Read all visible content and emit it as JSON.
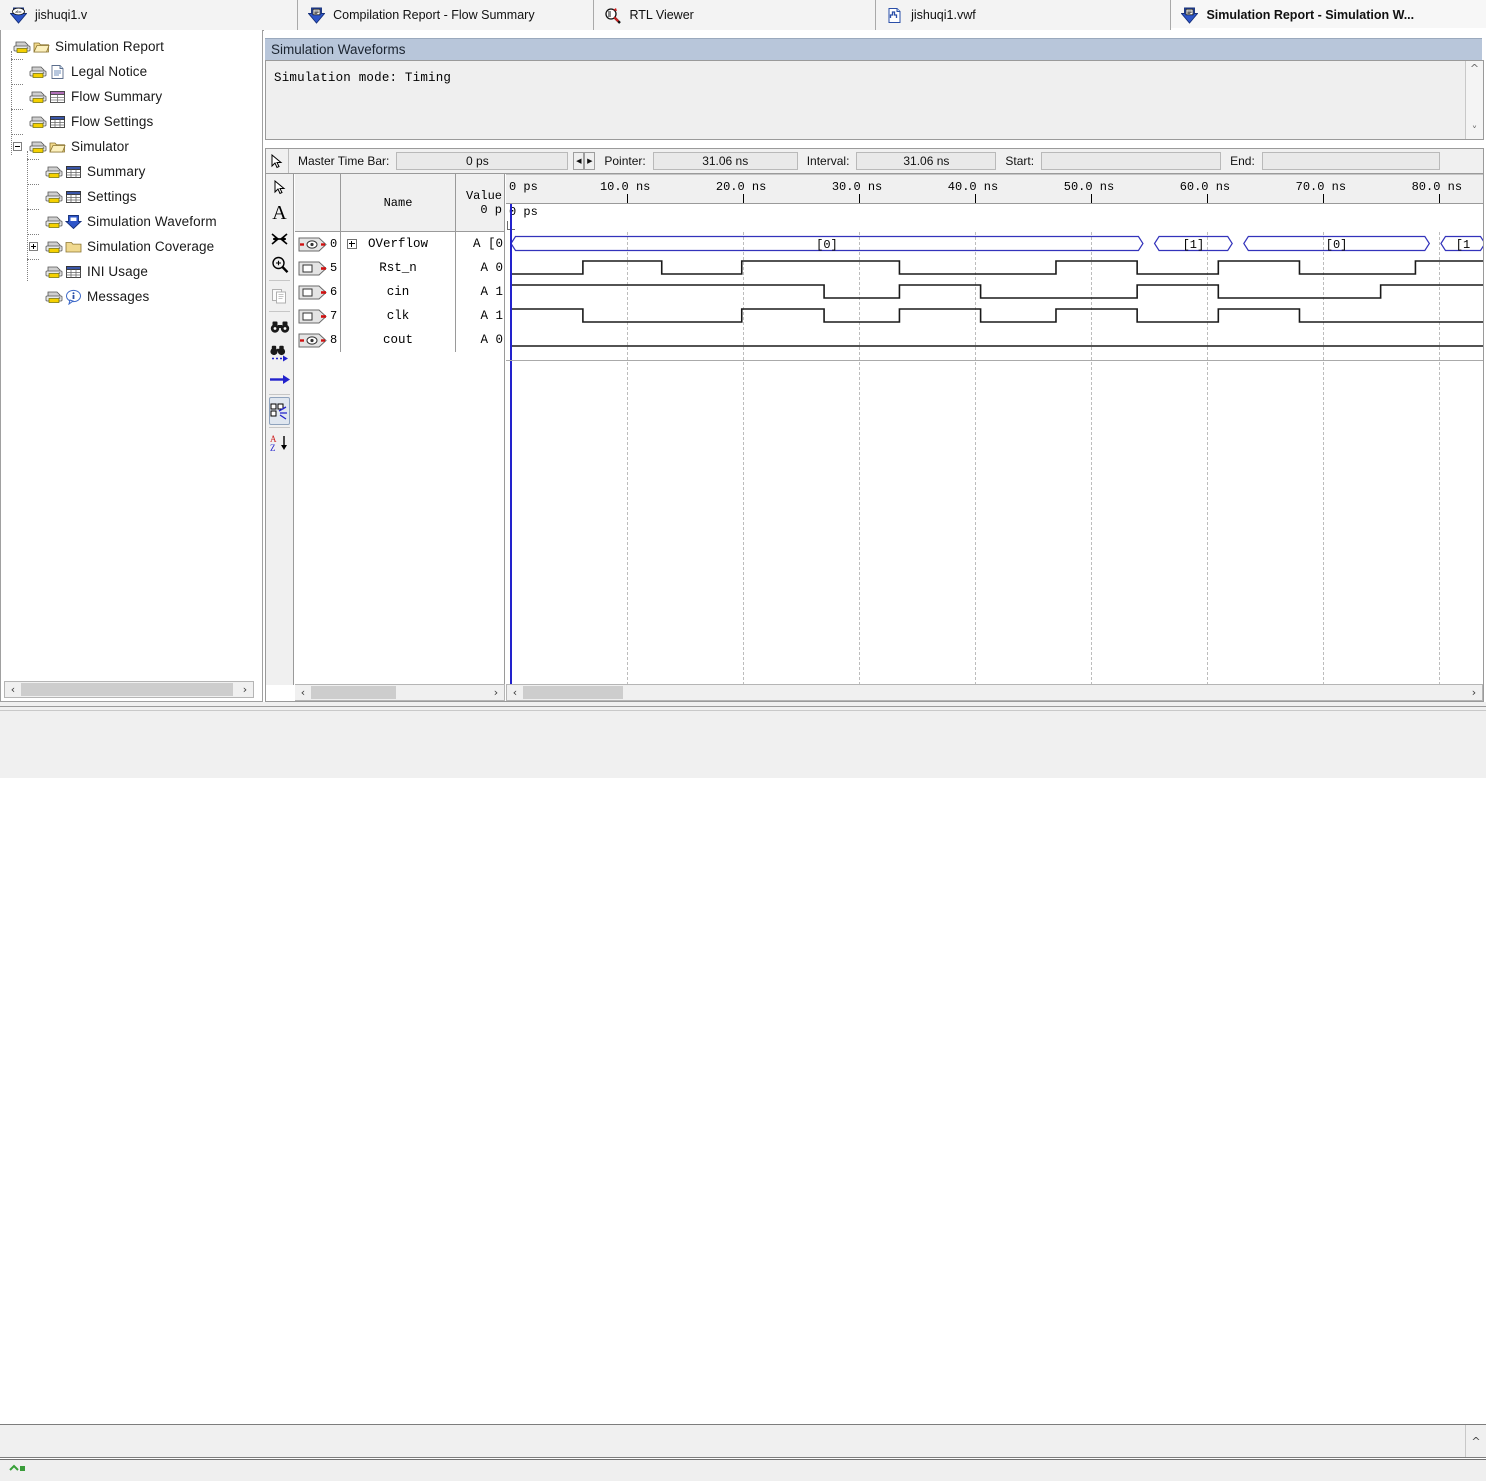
{
  "tabs": [
    {
      "label": "jishuqi1.v",
      "icon": "verilog-file-icon",
      "active": false
    },
    {
      "label": "Compilation Report - Flow Summary",
      "icon": "report-icon",
      "active": false
    },
    {
      "label": "RTL Viewer",
      "icon": "rtl-viewer-icon",
      "active": false
    },
    {
      "label": "jishuqi1.vwf",
      "icon": "waveform-file-icon",
      "active": false
    },
    {
      "label": "Simulation Report - Simulation W...",
      "icon": "report-icon",
      "active": true
    }
  ],
  "tree": {
    "items": [
      {
        "label": "Simulation Report",
        "icon": "folder-icon",
        "depth": 0,
        "expander": "none"
      },
      {
        "label": "Legal Notice",
        "icon": "document-icon",
        "depth": 1,
        "expander": "none"
      },
      {
        "label": "Flow Summary",
        "icon": "table-purple-icon",
        "depth": 1,
        "expander": "none"
      },
      {
        "label": "Flow Settings",
        "icon": "table-blue-icon",
        "depth": 1,
        "expander": "none"
      },
      {
        "label": "Simulator",
        "icon": "folder-icon",
        "depth": 1,
        "expander": "minus"
      },
      {
        "label": "Summary",
        "icon": "table-blue-icon",
        "depth": 2,
        "expander": "none"
      },
      {
        "label": "Settings",
        "icon": "table-blue-icon",
        "depth": 2,
        "expander": "none"
      },
      {
        "label": "Simulation Waveform",
        "icon": "waveform-icon",
        "depth": 2,
        "expander": "none"
      },
      {
        "label": "Simulation Coverage",
        "icon": "folder-closed-icon",
        "depth": 2,
        "expander": "plus"
      },
      {
        "label": "INI Usage",
        "icon": "table-blue-icon",
        "depth": 2,
        "expander": "none"
      },
      {
        "label": "Messages",
        "icon": "info-icon",
        "depth": 2,
        "expander": "none"
      }
    ]
  },
  "panel": {
    "header": "Simulation Waveforms",
    "mode_text": "Simulation mode: Timing"
  },
  "timebar": {
    "master_time_bar_label": "Master Time Bar:",
    "master_time_bar_value": "0 ps",
    "pointer_label": "Pointer:",
    "pointer_value": "31.06 ns",
    "interval_label": "Interval:",
    "interval_value": "31.06 ns",
    "start_label": "Start:",
    "start_value": "",
    "end_label": "End:",
    "end_value": ""
  },
  "vtools": [
    {
      "name": "selection-tool-icon",
      "glyph": "arrow"
    },
    {
      "name": "text-tool-icon",
      "glyph": "A"
    },
    {
      "name": "waveform-editing-tool-icon",
      "glyph": "scissors"
    },
    {
      "name": "zoom-tool-icon",
      "glyph": "magnifier"
    },
    {
      "name": "copy-icon",
      "glyph": "copy"
    },
    {
      "name": "find-icon",
      "glyph": "binoculars"
    },
    {
      "name": "find-next-icon",
      "glyph": "binoculars-next"
    },
    {
      "name": "goto-icon",
      "glyph": "arrow-right"
    },
    {
      "name": "group-ungroup-icon",
      "glyph": "nodes"
    },
    {
      "name": "sort-icon",
      "glyph": "az-sort"
    }
  ],
  "wave_table": {
    "headers": {
      "num": "",
      "name": "Name",
      "value_line1": "Value",
      "value_line2": "0 p"
    },
    "rows": [
      {
        "num": "0",
        "name": "OVerflow",
        "value": "A [0",
        "icon": "bidir-pin-icon",
        "expander": "plus"
      },
      {
        "num": "5",
        "name": "Rst_n",
        "value": "A 0",
        "icon": "input-pin-icon",
        "expander": "none"
      },
      {
        "num": "6",
        "name": "cin",
        "value": "A 1",
        "icon": "input-pin-icon",
        "expander": "none"
      },
      {
        "num": "7",
        "name": "clk",
        "value": "A 1",
        "icon": "input-pin-icon",
        "expander": "none"
      },
      {
        "num": "8",
        "name": "cout",
        "value": "A 0",
        "icon": "bidir-pin-icon",
        "expander": "none"
      }
    ]
  },
  "chart_data": {
    "type": "waveform",
    "title": "Simulation Waveforms",
    "time_unit": "ns",
    "xlim": [
      0,
      84.0
    ],
    "axis_ticks": [
      "0 ps",
      "10.0 ns",
      "20.0 ns",
      "30.0 ns",
      "40.0 ns",
      "50.0 ns",
      "60.0 ns",
      "70.0 ns",
      "80.0 ns"
    ],
    "axis_tick_times": [
      0,
      10,
      20,
      30,
      40,
      50,
      60,
      70,
      80
    ],
    "master_time_bar_time": 0,
    "bus_row": {
      "name": "OVerflow",
      "segments": [
        {
          "label": "[0]",
          "start": 0,
          "end": 54.5
        },
        {
          "label": "[1]",
          "start": 55.5,
          "end": 62.2
        },
        {
          "label": "[0]",
          "start": 63.2,
          "end": 79.2
        },
        {
          "label": "[1",
          "start": 80.2,
          "end": 84.0
        }
      ]
    },
    "signals": [
      {
        "name": "Rst_n",
        "initial": 0,
        "edges": [
          {
            "t": 6.2,
            "v": 1
          },
          {
            "t": 13.0,
            "v": 0
          },
          {
            "t": 19.9,
            "v": 1
          },
          {
            "t": 33.5,
            "v": 0
          },
          {
            "t": 47.0,
            "v": 1
          },
          {
            "t": 54.0,
            "v": 0
          },
          {
            "t": 61.0,
            "v": 1
          },
          {
            "t": 68.0,
            "v": 0
          },
          {
            "t": 78.0,
            "v": 1
          }
        ]
      },
      {
        "name": "cin",
        "initial": 1,
        "edges": [
          {
            "t": 27.0,
            "v": 0
          },
          {
            "t": 33.5,
            "v": 1
          },
          {
            "t": 40.5,
            "v": 0
          },
          {
            "t": 54.0,
            "v": 1
          },
          {
            "t": 61.0,
            "v": 0
          },
          {
            "t": 75.0,
            "v": 1
          }
        ]
      },
      {
        "name": "clk",
        "initial": 1,
        "edges": [
          {
            "t": 6.2,
            "v": 0
          },
          {
            "t": 19.9,
            "v": 1
          },
          {
            "t": 27.0,
            "v": 0
          },
          {
            "t": 33.5,
            "v": 1
          },
          {
            "t": 40.5,
            "v": 0
          },
          {
            "t": 47.0,
            "v": 1
          },
          {
            "t": 54.0,
            "v": 0
          },
          {
            "t": 61.0,
            "v": 1
          },
          {
            "t": 68.0,
            "v": 0
          }
        ]
      },
      {
        "name": "cout",
        "initial": 0,
        "edges": []
      }
    ]
  },
  "scrollbars": {
    "tree_hscroll_left": "‹",
    "tree_hscroll_right": "›",
    "name_hscroll_left": "‹",
    "name_hscroll_right": "›",
    "wave_hscroll_left": "‹",
    "wave_hscroll_right": "›",
    "vscroll_up": "⌃",
    "vscroll_down": "⌄"
  }
}
